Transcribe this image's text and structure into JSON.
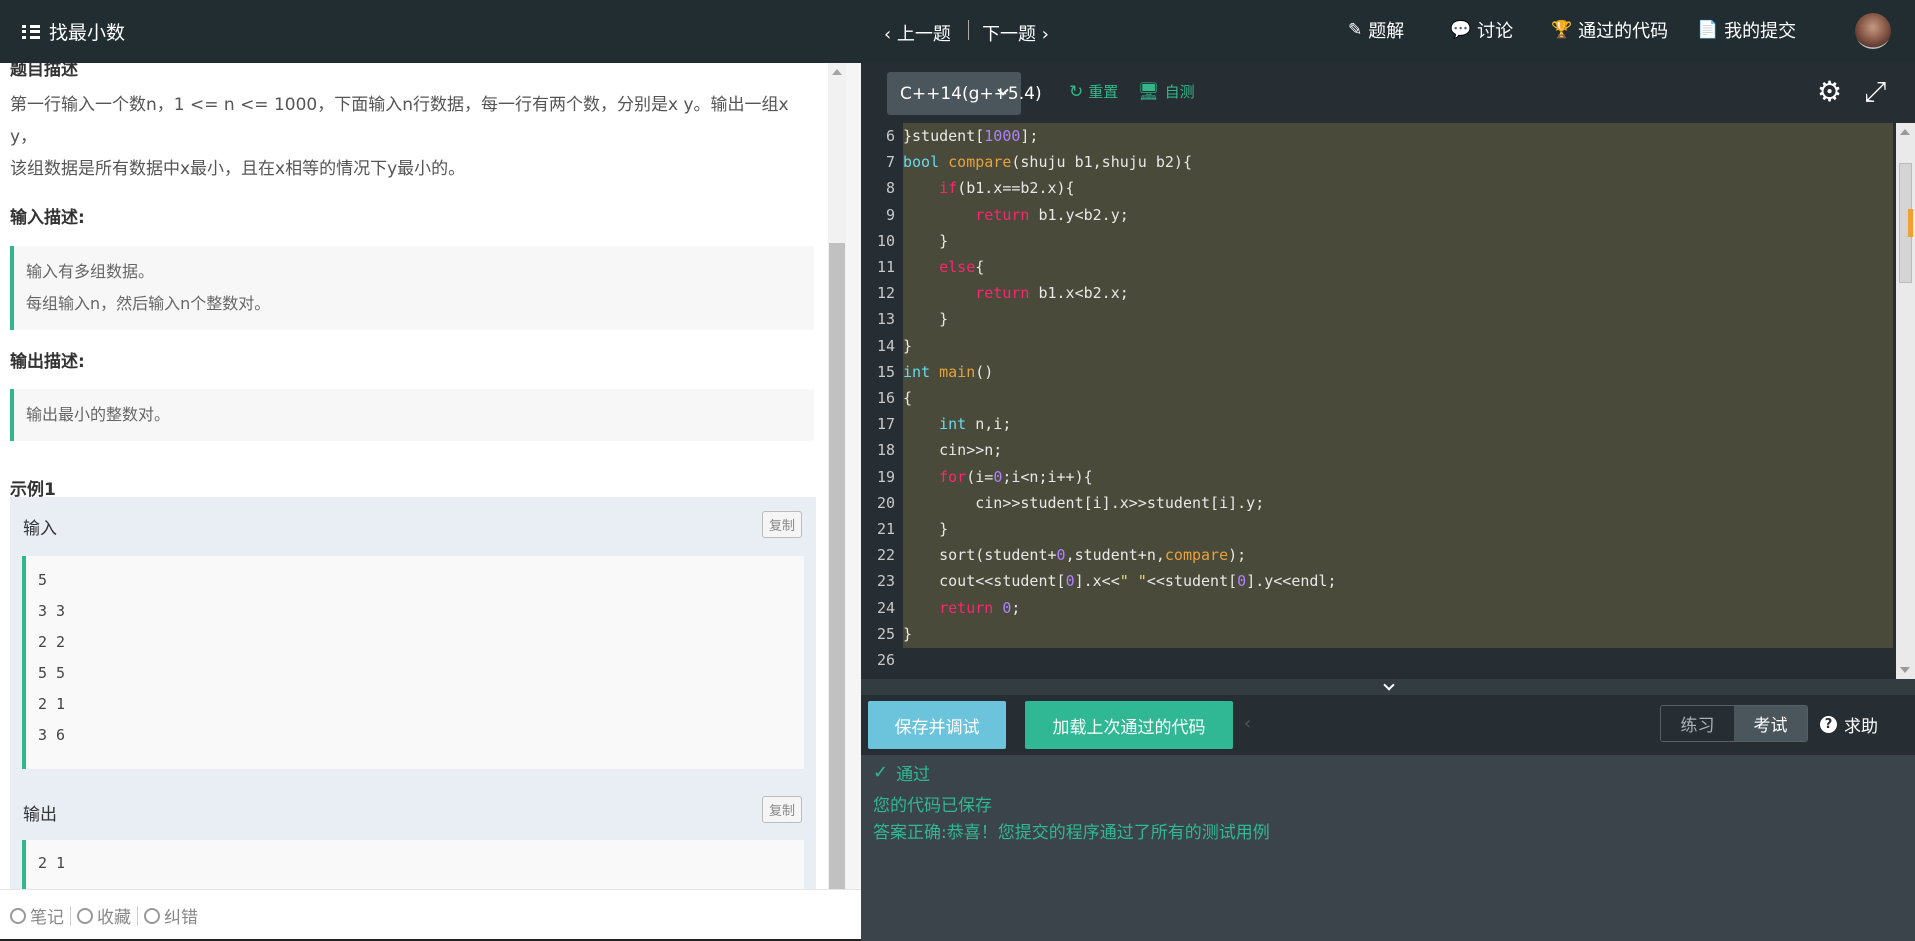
{
  "left_header": {
    "title": "找最小数",
    "icon": "list-icon"
  },
  "problem": {
    "desc_heading": "题目描述",
    "desc_lines": [
      "第一行输入一个数n，1 <= n <= 1000，下面输入n行数据，每一行有两个数，分别是x y。输出一组x y，",
      "该组数据是所有数据中x最小，且在x相等的情况下y最小的。"
    ],
    "input_heading": "输入描述:",
    "input_lines": [
      "输入有多组数据。",
      "每组输入n，然后输入n个整数对。"
    ],
    "output_heading": "输出描述:",
    "output_lines": [
      "输出最小的整数对。"
    ],
    "example_heading": "示例1",
    "example_input_label": "输入",
    "example_output_label": "输出",
    "copy_label": "复制",
    "example_input_lines": [
      "5",
      "3 3",
      "2 2",
      "5 5",
      "2 1",
      "3 6"
    ],
    "example_output_lines": [
      "2 1"
    ]
  },
  "left_footer": {
    "note": "笔记",
    "favorite": "收藏",
    "report": "纠错"
  },
  "right_header": {
    "prev": "上一题",
    "next": "下一题",
    "solution": "题解",
    "discuss": "讨论",
    "passed_code": "通过的代码",
    "my_submissions": "我的提交"
  },
  "toolbar": {
    "language": "C++14(g++5.4)",
    "reset": "重置",
    "self_test": "自测"
  },
  "code_lines": [
    {
      "n": "6",
      "t": "}student[1000];"
    },
    {
      "n": "7",
      "t": "bool compare(shuju b1,shuju b2){"
    },
    {
      "n": "8",
      "t": "    if(b1.x==b2.x){"
    },
    {
      "n": "9",
      "t": "        return b1.y<b2.y;"
    },
    {
      "n": "10",
      "t": "    }"
    },
    {
      "n": "11",
      "t": "    else{"
    },
    {
      "n": "12",
      "t": "        return b1.x<b2.x;"
    },
    {
      "n": "13",
      "t": "    }"
    },
    {
      "n": "14",
      "t": "}"
    },
    {
      "n": "15",
      "t": "int main()"
    },
    {
      "n": "16",
      "t": "{"
    },
    {
      "n": "17",
      "t": "    int n,i;"
    },
    {
      "n": "18",
      "t": "    cin>>n;"
    },
    {
      "n": "19",
      "t": "    for(i=0;i<n;i++){"
    },
    {
      "n": "20",
      "t": "        cin>>student[i].x>>student[i].y;"
    },
    {
      "n": "21",
      "t": "    }"
    },
    {
      "n": "22",
      "t": "    sort(student+0,student+n,compare);"
    },
    {
      "n": "23",
      "t": "    cout<<student[0].x<<\" \"<<student[0].y<<endl;"
    },
    {
      "n": "24",
      "t": "    return 0;"
    },
    {
      "n": "25",
      "t": "}"
    },
    {
      "n": "26",
      "t": ""
    }
  ],
  "actions": {
    "save_debug": "保存并调试",
    "load_last": "加载上次通过的代码",
    "practice": "练习",
    "exam": "考试",
    "help": "求助"
  },
  "result": {
    "status": "通过",
    "saved": "您的代码已保存",
    "correct": "答案正确:恭喜！您提交的程序通过了所有的测试用例"
  },
  "colors": {
    "accent": "#33b78a",
    "header_bg": "#222d32",
    "editor_bg": "#262e33"
  }
}
